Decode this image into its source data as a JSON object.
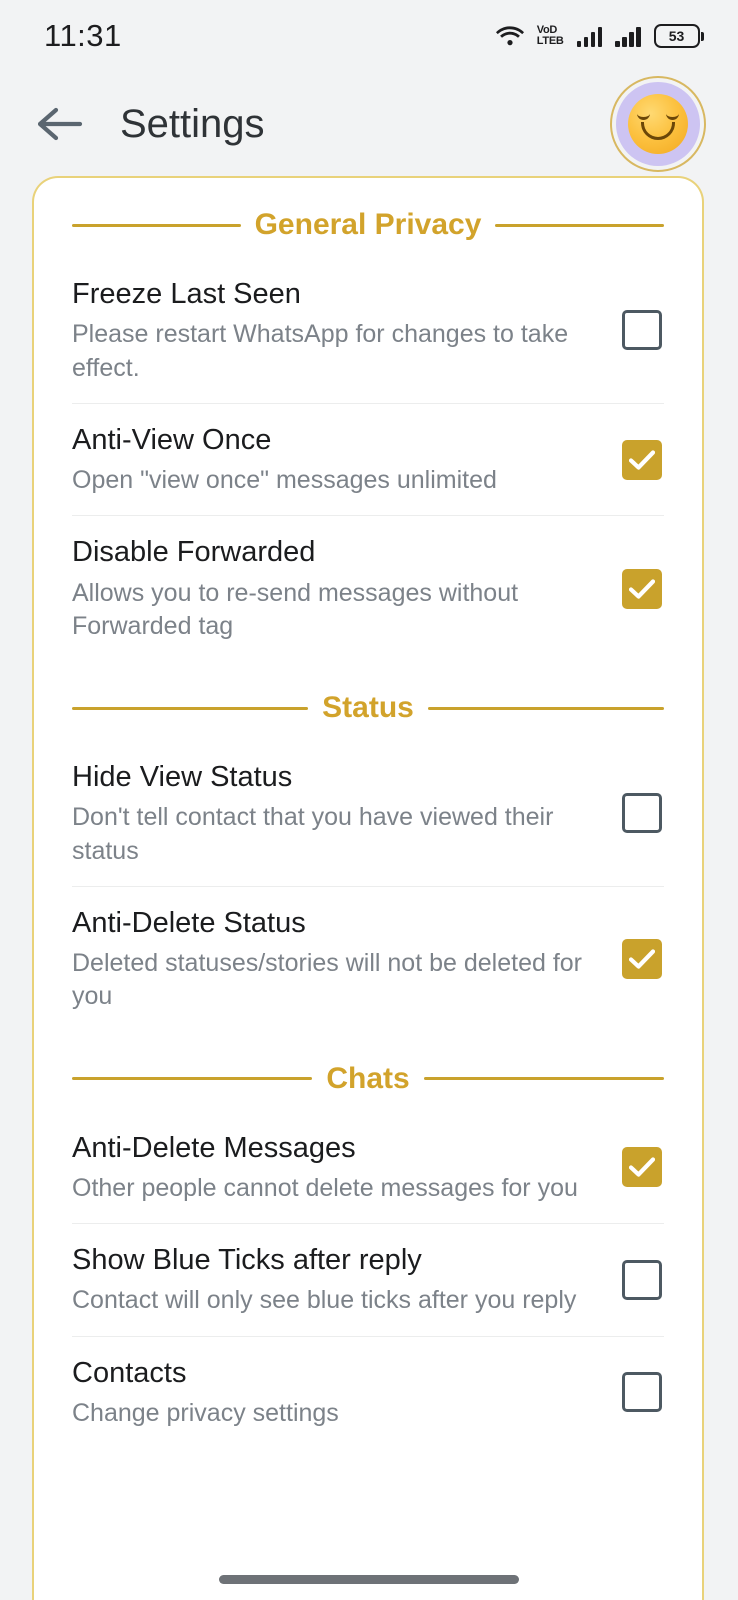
{
  "status_bar": {
    "time": "11:31",
    "wifi_icon": "wifi-icon",
    "volte_line1": "VoD",
    "volte_line2": "LTEB",
    "volte_label": "VoLTE",
    "signal_icon_1": "signal-bars-icon",
    "signal_icon_2": "signal-bars-icon",
    "battery_level": "53"
  },
  "app_bar": {
    "back_icon": "back-arrow-icon",
    "title": "Settings",
    "avatar_icon": "smiling-face-avatar"
  },
  "theme": {
    "accent_gold": "#c9a22c",
    "header_gold": "#d2a32b",
    "card_border": "#e9d27a",
    "checkbox_off_border": "#4d5962",
    "background": "#f2f3f4"
  },
  "sections": [
    {
      "label": "General Privacy",
      "rows": [
        {
          "title": "Freeze Last Seen",
          "subtitle": "Please restart WhatsApp for changes to take effect.",
          "checked": false
        },
        {
          "title": "Anti-View Once",
          "subtitle": "Open \"view once\" messages unlimited",
          "checked": true
        },
        {
          "title": "Disable Forwarded",
          "subtitle": "Allows you to re-send messages without Forwarded tag",
          "checked": true
        }
      ]
    },
    {
      "label": "Status",
      "rows": [
        {
          "title": "Hide View Status",
          "subtitle": "Don't tell contact that you have viewed their status",
          "checked": false
        },
        {
          "title": "Anti-Delete Status",
          "subtitle": "Deleted statuses/stories will not be deleted for you",
          "checked": true
        }
      ]
    },
    {
      "label": "Chats",
      "rows": [
        {
          "title": "Anti-Delete Messages",
          "subtitle": "Other people cannot delete messages for you",
          "checked": true
        },
        {
          "title": "Show Blue Ticks after reply",
          "subtitle": "Contact will only see blue ticks after you reply",
          "checked": false
        },
        {
          "title": "Contacts",
          "subtitle": "Change privacy settings",
          "checked": false,
          "clipped": true
        }
      ]
    }
  ],
  "navigation": {
    "gesture_bar": "gesture-home-indicator"
  }
}
